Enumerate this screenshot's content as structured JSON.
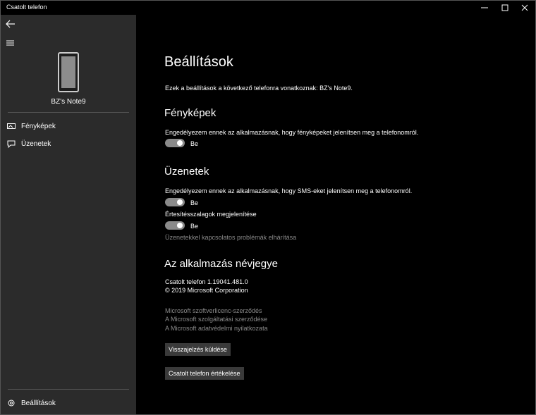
{
  "window": {
    "title": "Csatolt telefon"
  },
  "sidebar": {
    "phone_name": "BZ's Note9",
    "items": [
      {
        "label": "Fényképek",
        "icon": "photos-icon"
      },
      {
        "label": "Üzenetek",
        "icon": "messages-icon"
      }
    ],
    "settings_label": "Beállítások"
  },
  "main": {
    "title": "Beállítások",
    "intro": "Ezek a beállítások a következő telefonra vonatkoznak: BZ's Note9.",
    "photos": {
      "heading": "Fényképek",
      "description": "Engedélyezem ennek az alkalmazásnak, hogy fényképeket jelenítsen meg a telefonomról.",
      "toggle_label": "Be",
      "toggle_on": true
    },
    "messages": {
      "heading": "Üzenetek",
      "description": "Engedélyezem ennek az alkalmazásnak, hogy SMS-eket jelenítsen meg a telefonomról.",
      "toggle_label": "Be",
      "toggle_on": true,
      "banners_label": "Értesítésszalagok megjelenítése",
      "banners_toggle_label": "Be",
      "banners_toggle_on": true,
      "troubleshoot_link": "Üzenetekkel kapcsolatos problémák elhárítása"
    },
    "about": {
      "heading": "Az alkalmazás névjegye",
      "version": "Csatolt telefon 1.19041.481.0",
      "copyright": "© 2019 Microsoft Corporation",
      "links": [
        "Microsoft szoftverlicenc-szerződés",
        "A Microsoft szolgáltatási szerződése",
        "A Microsoft adatvédelmi nyilatkozata"
      ],
      "feedback_button": "Visszajelzés küldése",
      "rate_button": "Csatolt telefon értékelése"
    }
  }
}
